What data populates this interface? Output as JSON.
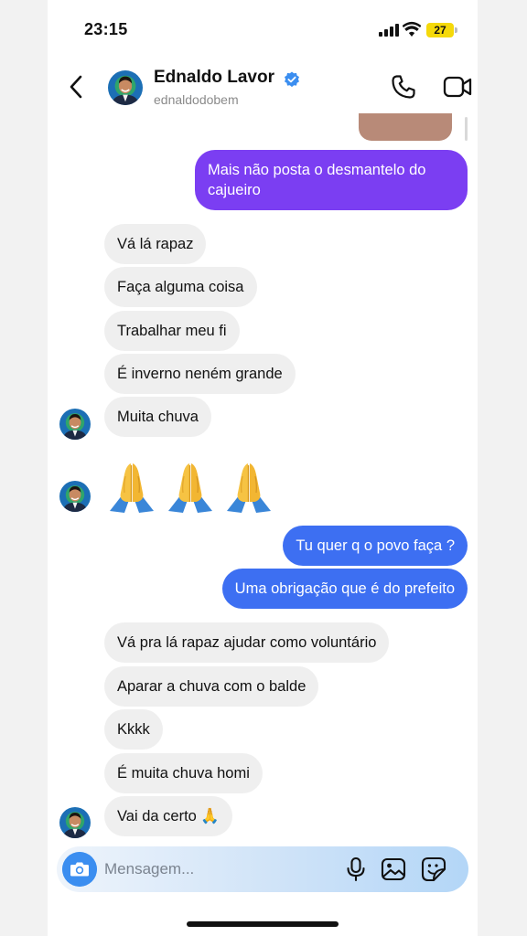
{
  "status_bar": {
    "time": "23:15",
    "battery": "27",
    "icons": [
      "signal-icon",
      "wifi-icon",
      "battery-icon"
    ]
  },
  "header": {
    "name": "Ednaldo Lavor",
    "username": "ednaldodobem",
    "icons": [
      "back-chevron-icon",
      "verified-badge-icon",
      "phone-call-icon",
      "video-camera-icon"
    ]
  },
  "messages": [
    {
      "sender": "me",
      "text": "Mais não posta o desmantelo do cajueiro"
    },
    {
      "sender": "them",
      "text": "Vá lá rapaz"
    },
    {
      "sender": "them",
      "text": "Faça alguma coisa"
    },
    {
      "sender": "them",
      "text": "Trabalhar meu fi"
    },
    {
      "sender": "them",
      "text": "É inverno neném grande"
    },
    {
      "sender": "them",
      "text": "Muita chuva"
    },
    {
      "sender": "them",
      "text": "🙏🙏🙏"
    },
    {
      "sender": "me",
      "text": "Tu quer q o povo faça ?"
    },
    {
      "sender": "me",
      "text": "Uma obrigação que é do prefeito"
    },
    {
      "sender": "them",
      "text": "Vá pra lá rapaz ajudar como voluntário"
    },
    {
      "sender": "them",
      "text": "Aparar a chuva com o balde"
    },
    {
      "sender": "them",
      "text": "Kkkk"
    },
    {
      "sender": "them",
      "text": "É muita chuva homi"
    },
    {
      "sender": "them",
      "text": "Vai da certo 🙏"
    }
  ],
  "composer": {
    "placeholder": "Mensagem...",
    "icons": [
      "camera-icon",
      "microphone-icon",
      "gallery-icon",
      "sticker-icon"
    ]
  },
  "colors": {
    "outgoing_purple": "#7b3ef2",
    "outgoing_blue": "#3d6ff2",
    "incoming_gray": "#efefef",
    "verified_blue": "#3b8ef0",
    "battery_yellow": "#f5d90a"
  }
}
